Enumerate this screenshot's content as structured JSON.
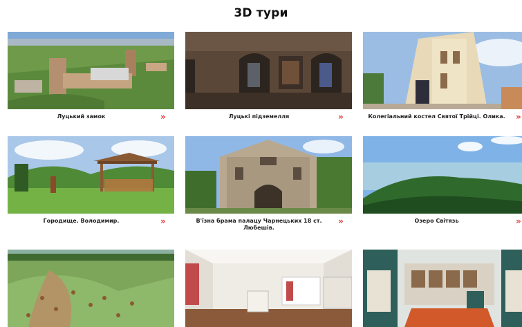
{
  "page": {
    "title": "3D тури"
  },
  "tours": [
    {
      "label": "Луцький замок"
    },
    {
      "label": "Луцькі підземелля"
    },
    {
      "label": "Колегіальний костел Святої Трійці. Олика."
    },
    {
      "label": "Городище. Володимир."
    },
    {
      "label": "В'їзна брама палацу Чарнецьких 18 ст. Любешів."
    },
    {
      "label": "Озеро Світязь"
    },
    {
      "label": ""
    },
    {
      "label": ""
    },
    {
      "label": ""
    }
  ],
  "chevron_glyph": "»",
  "colors": {
    "accent": "#e03a3a"
  }
}
